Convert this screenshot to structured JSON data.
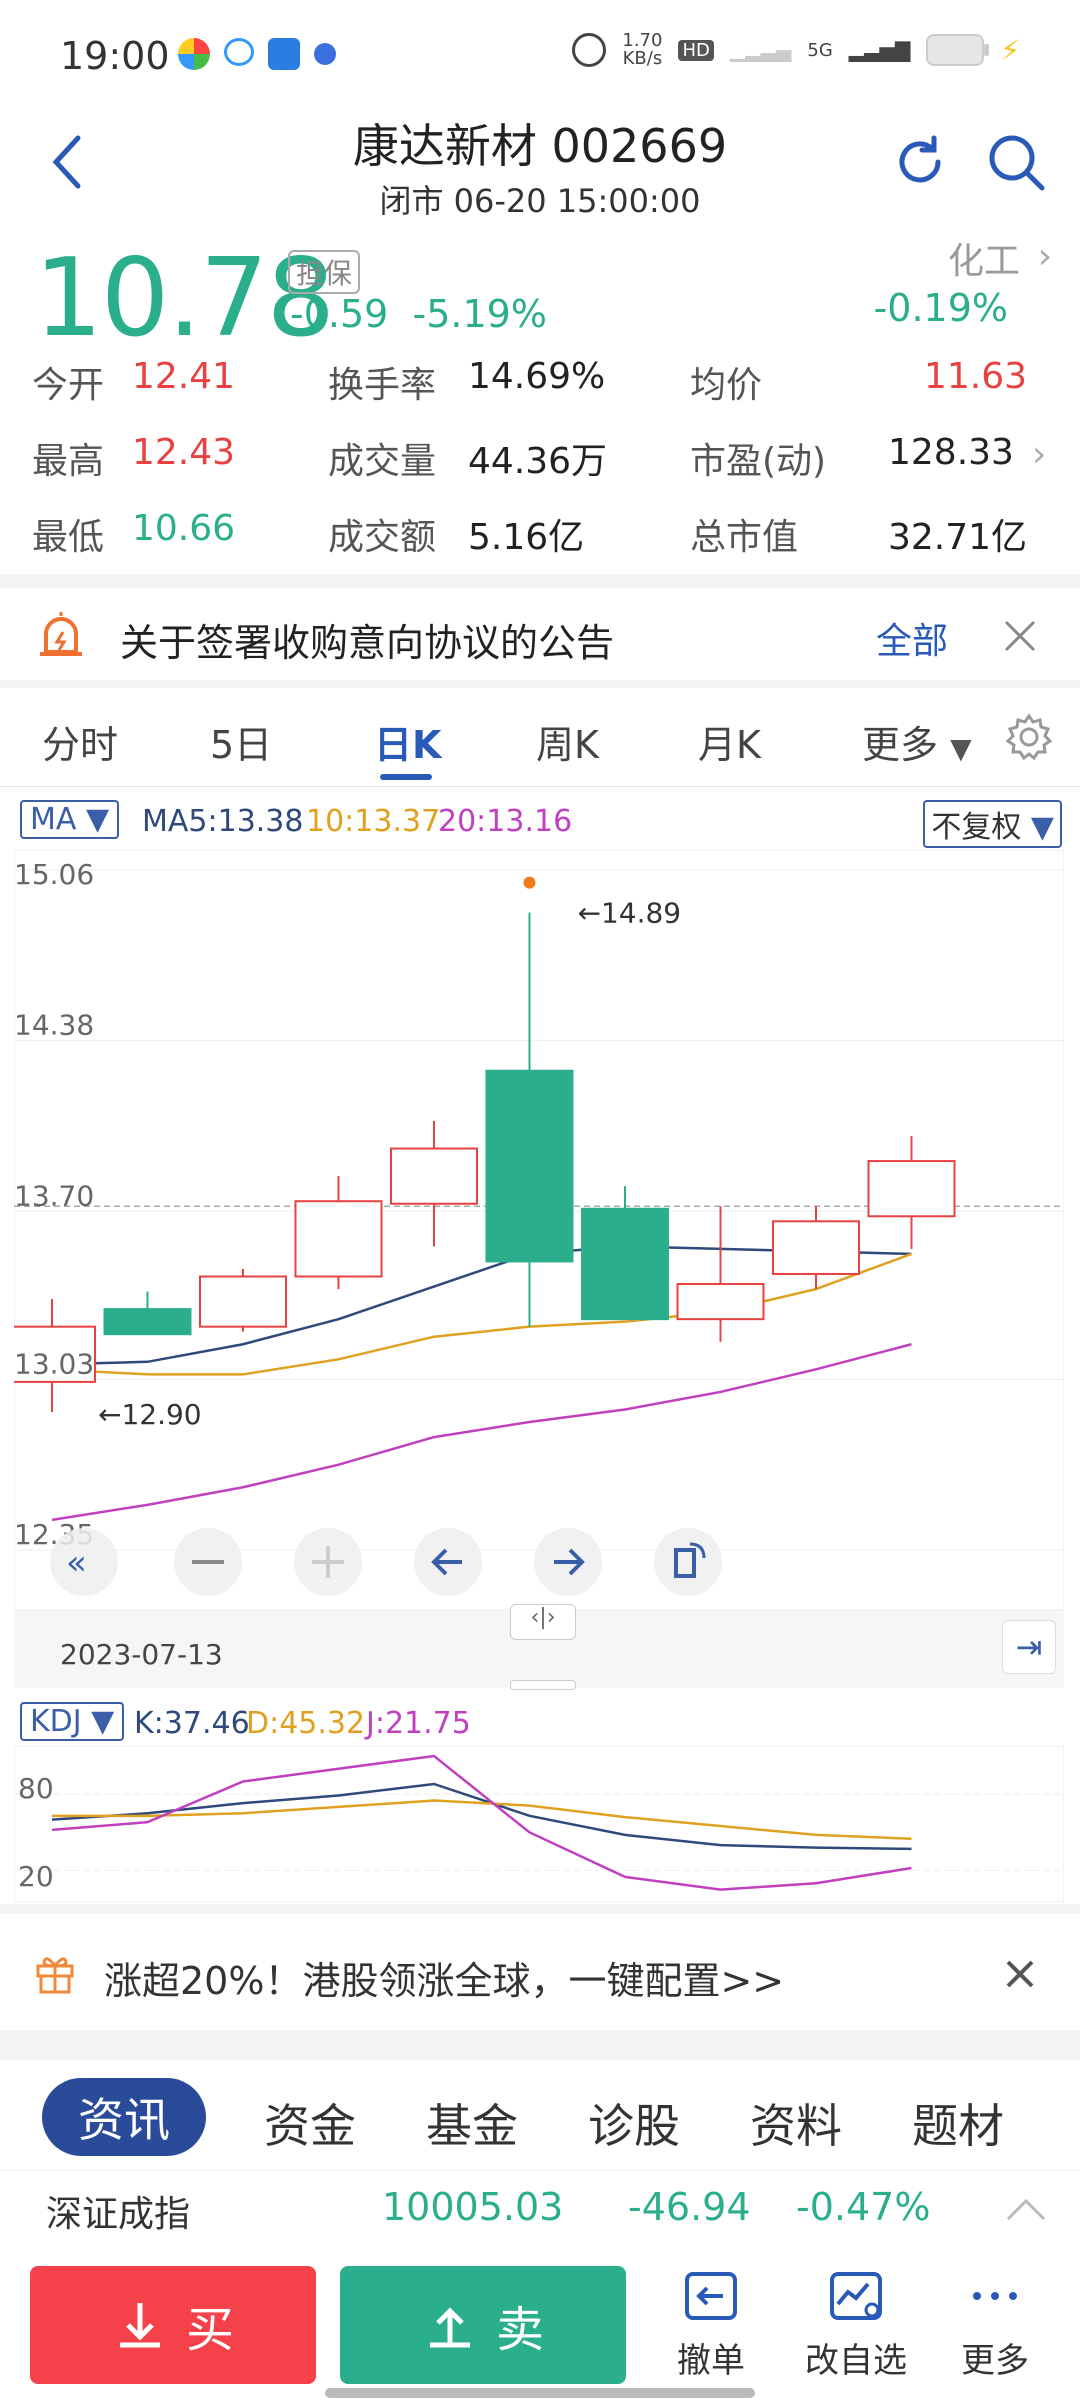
{
  "status": {
    "time": "19:00",
    "net_speed_top": "1.70",
    "net_speed_unit": "KB/s",
    "hd": "HD",
    "signal": "5G"
  },
  "header": {
    "title": "康达新材 002669",
    "subtitle": "闭市 06-20 15:00:00"
  },
  "quote": {
    "price": "10.78",
    "badge": "担保",
    "change": "-0.59",
    "change_pct": "-5.19%",
    "sector": "化工",
    "sector_change": "-0.19%"
  },
  "stats": {
    "open_label": "今开",
    "open": "12.41",
    "turnover_label": "换手率",
    "turnover": "14.69%",
    "avg_label": "均价",
    "avg": "11.63",
    "high_label": "最高",
    "high": "12.43",
    "volume_label": "成交量",
    "volume": "44.36万",
    "pe_label": "市盈(动)",
    "pe": "128.33",
    "low_label": "最低",
    "low": "10.66",
    "amount_label": "成交额",
    "amount": "5.16亿",
    "mcap_label": "总市值",
    "mcap": "32.71亿"
  },
  "notice": {
    "text": "关于签署收购意向协议的公告",
    "all_label": "全部"
  },
  "tabs": [
    "分时",
    "5日",
    "日K",
    "周K",
    "月K",
    "更多"
  ],
  "chart_header": {
    "ma_select": "MA",
    "ma5": "MA5:13.38",
    "ma10": "10:13.37",
    "ma20": "20:13.16",
    "fq_select": "不复权"
  },
  "chart_labels": {
    "y_ticks": [
      "15.06",
      "14.38",
      "13.70",
      "13.03",
      "12.35"
    ],
    "max_label": "←14.89",
    "min_label": "←12.90",
    "date": "2023-07-13"
  },
  "kdj": {
    "select": "KDJ",
    "k": "K:37.46",
    "d": "D:45.32",
    "j": "J:21.75",
    "ticks": [
      "80",
      "20"
    ]
  },
  "chart_data": {
    "type": "candlestick",
    "ylim": [
      12.35,
      15.06
    ],
    "candles": [
      {
        "o": 13.02,
        "c": 13.24,
        "h": 13.35,
        "l": 12.9
      },
      {
        "o": 13.31,
        "c": 13.21,
        "h": 13.38,
        "l": 13.21
      },
      {
        "o": 13.24,
        "c": 13.44,
        "h": 13.47,
        "l": 13.22
      },
      {
        "o": 13.44,
        "c": 13.74,
        "h": 13.84,
        "l": 13.39
      },
      {
        "o": 13.73,
        "c": 13.95,
        "h": 14.06,
        "l": 13.56
      },
      {
        "o": 14.26,
        "c": 13.5,
        "h": 14.89,
        "l": 13.24
      },
      {
        "o": 13.71,
        "c": 13.27,
        "h": 13.8,
        "l": 13.27
      },
      {
        "o": 13.27,
        "c": 13.41,
        "h": 13.72,
        "l": 13.18
      },
      {
        "o": 13.45,
        "c": 13.66,
        "h": 13.72,
        "l": 13.39
      },
      {
        "o": 13.68,
        "c": 13.9,
        "h": 14.0,
        "l": 13.55
      }
    ],
    "ma5": [
      13.09,
      13.1,
      13.17,
      13.27,
      13.4,
      13.53,
      13.56,
      13.55,
      13.54,
      13.53
    ],
    "ma10": [
      13.07,
      13.05,
      13.05,
      13.11,
      13.2,
      13.24,
      13.26,
      13.3,
      13.39,
      13.53
    ],
    "ma20": [
      12.47,
      12.53,
      12.6,
      12.69,
      12.8,
      12.86,
      12.91,
      12.98,
      13.07,
      13.17
    ],
    "kdj_k": [
      60,
      65,
      73,
      79,
      88,
      63,
      48,
      40,
      38,
      37
    ],
    "kdj_d": [
      63,
      63,
      65,
      70,
      75,
      71,
      62,
      55,
      48,
      45
    ],
    "kdj_j": [
      52,
      58,
      90,
      100,
      110,
      50,
      15,
      5,
      10,
      22
    ]
  },
  "ad": {
    "text": "涨超20%！港股领涨全球，一键配置>>"
  },
  "news_tabs": [
    "资讯",
    "资金",
    "基金",
    "诊股",
    "资料",
    "题材"
  ],
  "index": {
    "name": "深证成指",
    "value": "10005.03",
    "change": "-46.94",
    "pct": "-0.47%"
  },
  "bottom": {
    "buy": "买",
    "sell": "卖",
    "cancel": "撤单",
    "edit_watch": "改自选",
    "more": "更多"
  }
}
